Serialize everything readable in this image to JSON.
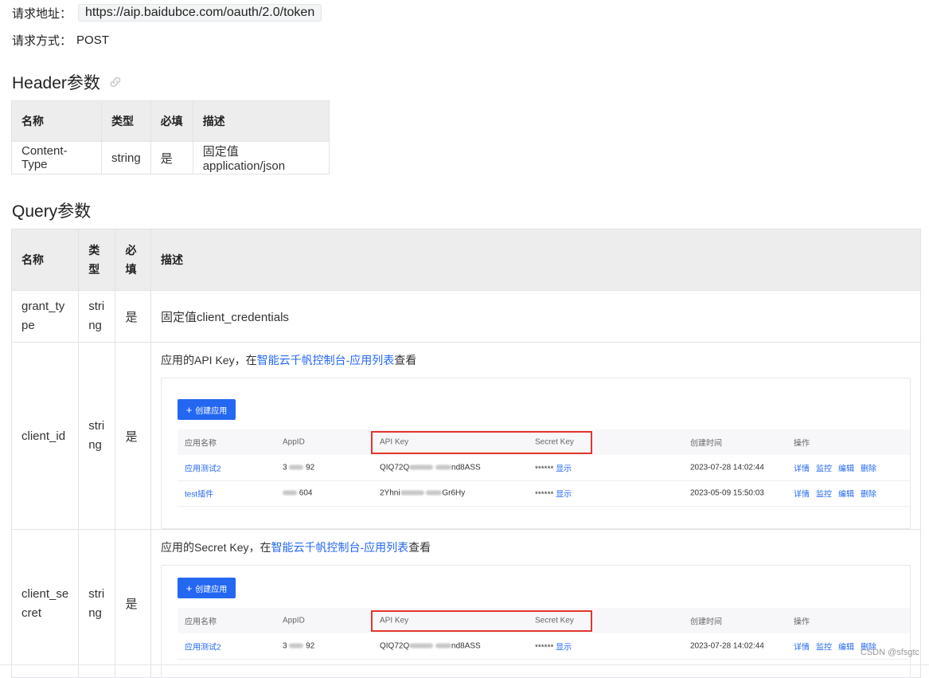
{
  "request": {
    "url_label": "请求地址：",
    "url": "https://aip.baidubce.com/oauth/2.0/token",
    "method_label": "请求方式：",
    "method": "POST"
  },
  "header_section": {
    "title": "Header参数",
    "columns": [
      "名称",
      "类型",
      "必填",
      "描述"
    ],
    "rows": [
      {
        "name": "Content-Type",
        "type": "string",
        "required": "是",
        "desc": "固定值application/json"
      }
    ]
  },
  "query_section": {
    "title": "Query参数",
    "columns": [
      "名称",
      "类型",
      "必填",
      "描述"
    ],
    "col_type_wrapped": "类\n型",
    "col_required_wrapped": "必\n填",
    "rows": [
      {
        "name": "grant_ty\npe",
        "type": "stri\nng",
        "required": "是",
        "desc": "固定值client_credentials"
      },
      {
        "name": "client_id",
        "type": "stri\nng",
        "required": "是",
        "desc_prefix": "应用的API Key，在",
        "desc_link": "智能云千帆控制台-应用列表",
        "desc_suffix": "查看"
      },
      {
        "name": "client_se\ncret",
        "type": "stri\nng",
        "required": "是",
        "desc_prefix": "应用的Secret Key，在",
        "desc_link": "智能云千帆控制台-应用列表",
        "desc_suffix": "查看"
      }
    ]
  },
  "console": {
    "create_button": "创建应用",
    "columns": [
      "应用名称",
      "AppID",
      "API Key",
      "Secret Key",
      "创建时间",
      "操作"
    ],
    "apps": [
      {
        "name": "应用测试2",
        "appid_a": "3",
        "appid_b": "92",
        "apikey_a": "QIQ72Q",
        "apikey_b": "nd8ASS",
        "secret_mask": "******",
        "show": "显示",
        "created": "2023-07-28 14:02:44"
      },
      {
        "name": "test插件",
        "appid_a": "",
        "appid_b": "604",
        "apikey_a": "2Yhni",
        "apikey_b": "Gr6Hy",
        "secret_mask": "******",
        "show": "显示",
        "created": "2023-05-09 15:50:03"
      }
    ],
    "ops": [
      "详情",
      "监控",
      "编辑",
      "删除"
    ]
  },
  "watermark": "CSDN @sfsgtc"
}
